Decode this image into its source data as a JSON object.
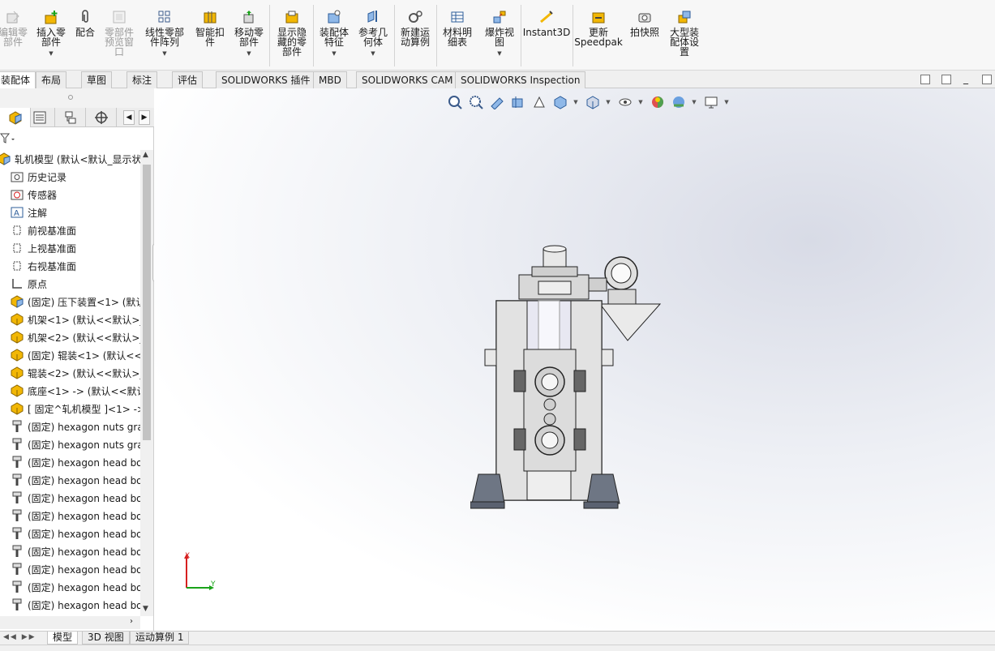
{
  "ribbon": {
    "buttons": [
      {
        "id": "edit-component",
        "label": "编辑零\n部件",
        "icon": "edit-component-icon",
        "disabled": true
      },
      {
        "id": "insert-component",
        "label": "插入零\n部件",
        "icon": "insert-component-icon",
        "dropdown": true
      },
      {
        "id": "mate",
        "label": "配合",
        "icon": "mate-paperclip-icon"
      },
      {
        "id": "component-preview",
        "label": "零部件\n预览窗\n口",
        "icon": "preview-window-icon",
        "disabled": true
      },
      {
        "id": "linear-pattern",
        "label": "线性零部\n件阵列",
        "icon": "linear-pattern-icon",
        "dropdown": true
      },
      {
        "id": "smart-fasteners",
        "label": "智能扣\n件",
        "icon": "smart-fasteners-icon"
      },
      {
        "id": "move-component",
        "label": "移动零\n部件",
        "icon": "move-component-icon",
        "dropdown": true
      },
      {
        "id": "show-hidden",
        "label": "显示隐\n藏的零\n部件",
        "icon": "show-hidden-icon"
      },
      {
        "id": "assembly-features",
        "label": "装配体\n特征",
        "icon": "assembly-features-icon",
        "dropdown": true
      },
      {
        "id": "reference-geometry",
        "label": "参考几\n何体",
        "icon": "reference-geometry-icon",
        "dropdown": true
      },
      {
        "id": "new-motion-study",
        "label": "新建运\n动算例",
        "icon": "motion-study-icon"
      },
      {
        "id": "bill-of-materials",
        "label": "材料明\n细表",
        "icon": "bom-table-icon"
      },
      {
        "id": "exploded-view",
        "label": "爆炸视\n图",
        "icon": "exploded-view-icon",
        "dropdown": true
      },
      {
        "id": "instant3d",
        "label": "Instant3D",
        "icon": "instant3d-icon"
      },
      {
        "id": "update-speedpak",
        "label": "更新\nSpeedpak",
        "icon": "speedpak-icon"
      },
      {
        "id": "take-snapshot",
        "label": "拍快照",
        "icon": "camera-icon"
      },
      {
        "id": "large-assembly",
        "label": "大型装\n配体设\n置",
        "icon": "large-assembly-icon"
      }
    ]
  },
  "command_tabs": [
    "装配体",
    "布局",
    "草图",
    "标注",
    "评估",
    "SOLIDWORKS 插件",
    "MBD",
    "SOLIDWORKS CAM",
    "SOLIDWORKS Inspection"
  ],
  "active_command_tab": "装配体",
  "feature_tree": {
    "root": "轧机模型 (默认<默认_显示状",
    "items": [
      {
        "label": "历史记录",
        "icon": "history-folder-icon"
      },
      {
        "label": "传感器",
        "icon": "sensor-icon"
      },
      {
        "label": "注解",
        "icon": "annotation-icon"
      },
      {
        "label": "前视基准面",
        "icon": "plane-icon"
      },
      {
        "label": "上视基准面",
        "icon": "plane-icon"
      },
      {
        "label": "右视基准面",
        "icon": "plane-icon"
      },
      {
        "label": "原点",
        "icon": "origin-icon"
      },
      {
        "label": "(固定) 压下装置<1> (默认",
        "icon": "subassembly-icon"
      },
      {
        "label": "机架<1> (默认<<默认>_",
        "icon": "part-icon"
      },
      {
        "label": "机架<2> (默认<<默认>_",
        "icon": "part-icon"
      },
      {
        "label": "(固定) 辊装<1> (默认<<",
        "icon": "part-icon"
      },
      {
        "label": "辊装<2> (默认<<默认>_",
        "icon": "part-icon"
      },
      {
        "label": "底座<1> -> (默认<<默认",
        "icon": "part-icon"
      },
      {
        "label": "[ 固定^轧机模型 ]<1> ->",
        "icon": "part-icon"
      },
      {
        "label": "(固定) hexagon nuts gra",
        "icon": "toolbox-bolt-icon"
      },
      {
        "label": "(固定) hexagon nuts gra",
        "icon": "toolbox-bolt-icon"
      },
      {
        "label": "(固定) hexagon head bo",
        "icon": "toolbox-bolt-icon"
      },
      {
        "label": "(固定) hexagon head bo",
        "icon": "toolbox-bolt-icon"
      },
      {
        "label": "(固定) hexagon head bo",
        "icon": "toolbox-bolt-icon"
      },
      {
        "label": "(固定) hexagon head bo",
        "icon": "toolbox-bolt-icon"
      },
      {
        "label": "(固定) hexagon head bo",
        "icon": "toolbox-bolt-icon"
      },
      {
        "label": "(固定) hexagon head bo",
        "icon": "toolbox-bolt-icon"
      },
      {
        "label": "(固定) hexagon head bo",
        "icon": "toolbox-bolt-icon"
      },
      {
        "label": "(固定) hexagon head bo",
        "icon": "toolbox-bolt-icon"
      },
      {
        "label": "(固定) hexagon head bo",
        "icon": "toolbox-bolt-icon"
      }
    ]
  },
  "triad": {
    "x_label": "Y",
    "y_label": "X"
  },
  "bottom_tabs": [
    "模型",
    "3D 视图",
    "运动算例 1"
  ],
  "active_bottom_tab": "模型",
  "colors": {
    "accent": "#1f6fd6",
    "part_yellow": "#f2b705",
    "triad_red": "#d62020",
    "triad_green": "#1aa31a"
  }
}
